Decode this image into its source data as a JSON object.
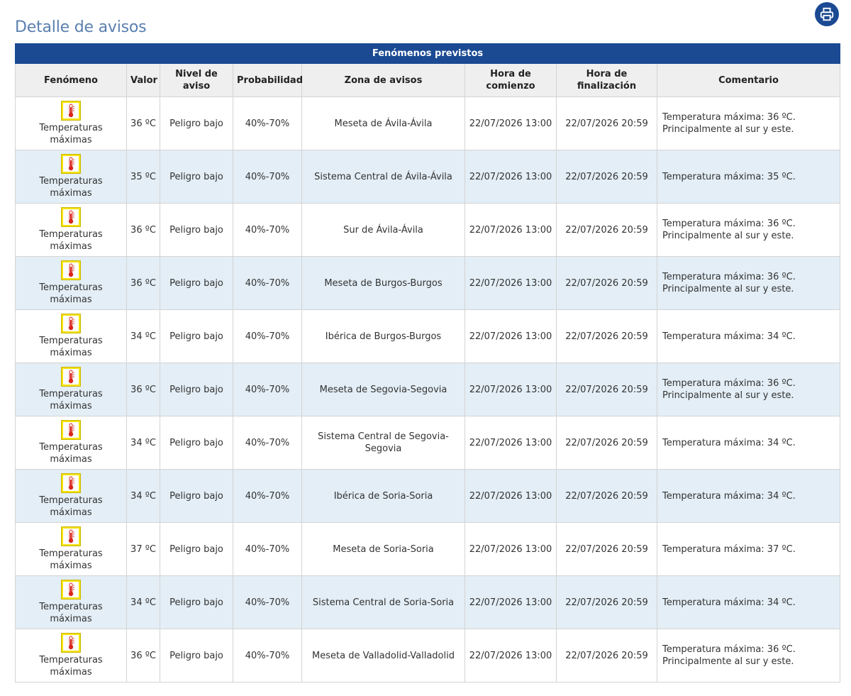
{
  "page": {
    "title": "Detalle de avisos"
  },
  "table": {
    "caption": "Fenómenos previstos",
    "headers": {
      "fenomeno": "Fenómeno",
      "valor": "Valor",
      "nivel": "Nivel de aviso",
      "probabilidad": "Probabilidad",
      "zona": "Zona de avisos",
      "comienzo": "Hora de comienzo",
      "fin": "Hora de finalización",
      "comentario": "Comentario"
    },
    "rows": [
      {
        "fenomeno": "Temperaturas máximas",
        "icon": "thermometer-icon",
        "valor": "36 ºC",
        "nivel": "Peligro bajo",
        "probabilidad": "40%-70%",
        "zona": "Meseta de Ávila-Ávila",
        "comienzo": "22/07/2026 13:00",
        "fin": "22/07/2026 20:59",
        "comentario": "Temperatura máxima: 36 ºC. Principalmente al sur y este."
      },
      {
        "fenomeno": "Temperaturas máximas",
        "icon": "thermometer-icon",
        "valor": "35 ºC",
        "nivel": "Peligro bajo",
        "probabilidad": "40%-70%",
        "zona": "Sistema Central de Ávila-Ávila",
        "comienzo": "22/07/2026 13:00",
        "fin": "22/07/2026 20:59",
        "comentario": "Temperatura máxima: 35 ºC."
      },
      {
        "fenomeno": "Temperaturas máximas",
        "icon": "thermometer-icon",
        "valor": "36 ºC",
        "nivel": "Peligro bajo",
        "probabilidad": "40%-70%",
        "zona": "Sur de Ávila-Ávila",
        "comienzo": "22/07/2026 13:00",
        "fin": "22/07/2026 20:59",
        "comentario": "Temperatura máxima: 36 ºC. Principalmente al sur y este."
      },
      {
        "fenomeno": "Temperaturas máximas",
        "icon": "thermometer-icon",
        "valor": "36 ºC",
        "nivel": "Peligro bajo",
        "probabilidad": "40%-70%",
        "zona": "Meseta de Burgos-Burgos",
        "comienzo": "22/07/2026 13:00",
        "fin": "22/07/2026 20:59",
        "comentario": "Temperatura máxima: 36 ºC. Principalmente al sur y este."
      },
      {
        "fenomeno": "Temperaturas máximas",
        "icon": "thermometer-icon",
        "valor": "34 ºC",
        "nivel": "Peligro bajo",
        "probabilidad": "40%-70%",
        "zona": "Ibérica de Burgos-Burgos",
        "comienzo": "22/07/2026 13:00",
        "fin": "22/07/2026 20:59",
        "comentario": "Temperatura máxima: 34 ºC."
      },
      {
        "fenomeno": "Temperaturas máximas",
        "icon": "thermometer-icon",
        "valor": "36 ºC",
        "nivel": "Peligro bajo",
        "probabilidad": "40%-70%",
        "zona": "Meseta de Segovia-Segovia",
        "comienzo": "22/07/2026 13:00",
        "fin": "22/07/2026 20:59",
        "comentario": "Temperatura máxima: 36 ºC. Principalmente al sur y este."
      },
      {
        "fenomeno": "Temperaturas máximas",
        "icon": "thermometer-icon",
        "valor": "34 ºC",
        "nivel": "Peligro bajo",
        "probabilidad": "40%-70%",
        "zona": "Sistema Central de Segovia-Segovia",
        "comienzo": "22/07/2026 13:00",
        "fin": "22/07/2026 20:59",
        "comentario": "Temperatura máxima: 34 ºC."
      },
      {
        "fenomeno": "Temperaturas máximas",
        "icon": "thermometer-icon",
        "valor": "34 ºC",
        "nivel": "Peligro bajo",
        "probabilidad": "40%-70%",
        "zona": "Ibérica de Soria-Soria",
        "comienzo": "22/07/2026 13:00",
        "fin": "22/07/2026 20:59",
        "comentario": "Temperatura máxima: 34 ºC."
      },
      {
        "fenomeno": "Temperaturas máximas",
        "icon": "thermometer-icon",
        "valor": "37 ºC",
        "nivel": "Peligro bajo",
        "probabilidad": "40%-70%",
        "zona": "Meseta de Soria-Soria",
        "comienzo": "22/07/2026 13:00",
        "fin": "22/07/2026 20:59",
        "comentario": "Temperatura máxima: 37 ºC."
      },
      {
        "fenomeno": "Temperaturas máximas",
        "icon": "thermometer-icon",
        "valor": "34 ºC",
        "nivel": "Peligro bajo",
        "probabilidad": "40%-70%",
        "zona": "Sistema Central de Soria-Soria",
        "comienzo": "22/07/2026 13:00",
        "fin": "22/07/2026 20:59",
        "comentario": "Temperatura máxima: 34 ºC."
      },
      {
        "fenomeno": "Temperaturas máximas",
        "icon": "thermometer-icon",
        "valor": "36 ºC",
        "nivel": "Peligro bajo",
        "probabilidad": "40%-70%",
        "zona": "Meseta de Valladolid-Valladolid",
        "comienzo": "22/07/2026 13:00",
        "fin": "22/07/2026 20:59",
        "comentario": "Temperatura máxima: 36 ºC. Principalmente al sur y este."
      }
    ]
  },
  "colors": {
    "brand_blue": "#1b4a93",
    "title_blue": "#5a7fb0",
    "row_alt": "#e3eef6",
    "warning_yellow": "#f5e20a",
    "thermometer_red": "#d8261c"
  }
}
